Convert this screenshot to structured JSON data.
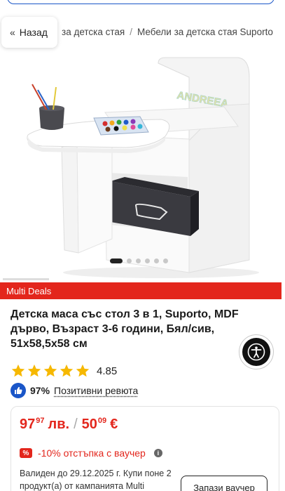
{
  "breadcrumb": {
    "back_label": "Назад",
    "trail": [
      "за детска стая",
      "Мебели за детска стая Suporto"
    ]
  },
  "gallery": {
    "slide_count": 6,
    "active_index": 0,
    "chair_name_text": "ANDREEA"
  },
  "badge": {
    "label": "Multi Deals"
  },
  "product": {
    "title": "Детска маса със стол 3 в 1, Suporto, MDF дърво, Възраст 3-6 години, Бял/сив, 51x58,5x58 см"
  },
  "rating": {
    "stars": 5,
    "value": "4.85"
  },
  "reviews": {
    "percent": "97%",
    "label": "Позитивни ревюта"
  },
  "price": {
    "bgn_whole": "97",
    "bgn_decimals": "97",
    "bgn_currency": "лв.",
    "separator": "/",
    "eur_whole": "50",
    "eur_decimals": "09",
    "eur_currency": "€"
  },
  "voucher": {
    "icon_text": "%",
    "label": "-10% отстъпка с ваучер",
    "validity": "Валиден до 29.12.2025 г. Купи поне 2 продукт(а) от кампанията Multi",
    "button": "Запази ваучер"
  },
  "colors": {
    "brand_red": "#e3261c",
    "link_blue": "#1a56c8",
    "star_yellow": "#f6b800"
  }
}
